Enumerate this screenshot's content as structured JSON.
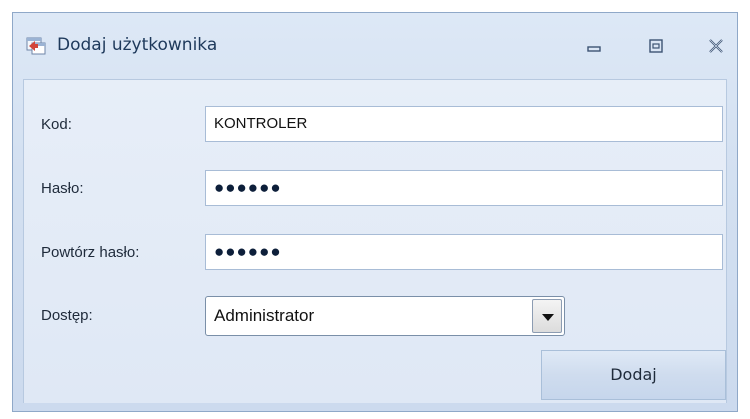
{
  "window": {
    "title": "Dodaj użytkownika",
    "icon": "add-user-app-icon",
    "controls": [
      "minimize-icon",
      "maximize-icon",
      "close-icon"
    ]
  },
  "form": {
    "code": {
      "label": "Kod:",
      "value": "KONTROLER"
    },
    "password": {
      "label": "Hasło:",
      "value": "●●●●●●"
    },
    "repeat_password": {
      "label": "Powtórz hasło:",
      "value": "●●●●●●"
    },
    "access": {
      "label": "Dostęp:",
      "selected": "Administrator"
    },
    "submit_label": "Dodaj"
  },
  "colors": {
    "title_text": "#1e395b",
    "window_bg": "#d3e0f1",
    "content_bg": "#e3ebf7",
    "border": "#8fa8c8"
  }
}
